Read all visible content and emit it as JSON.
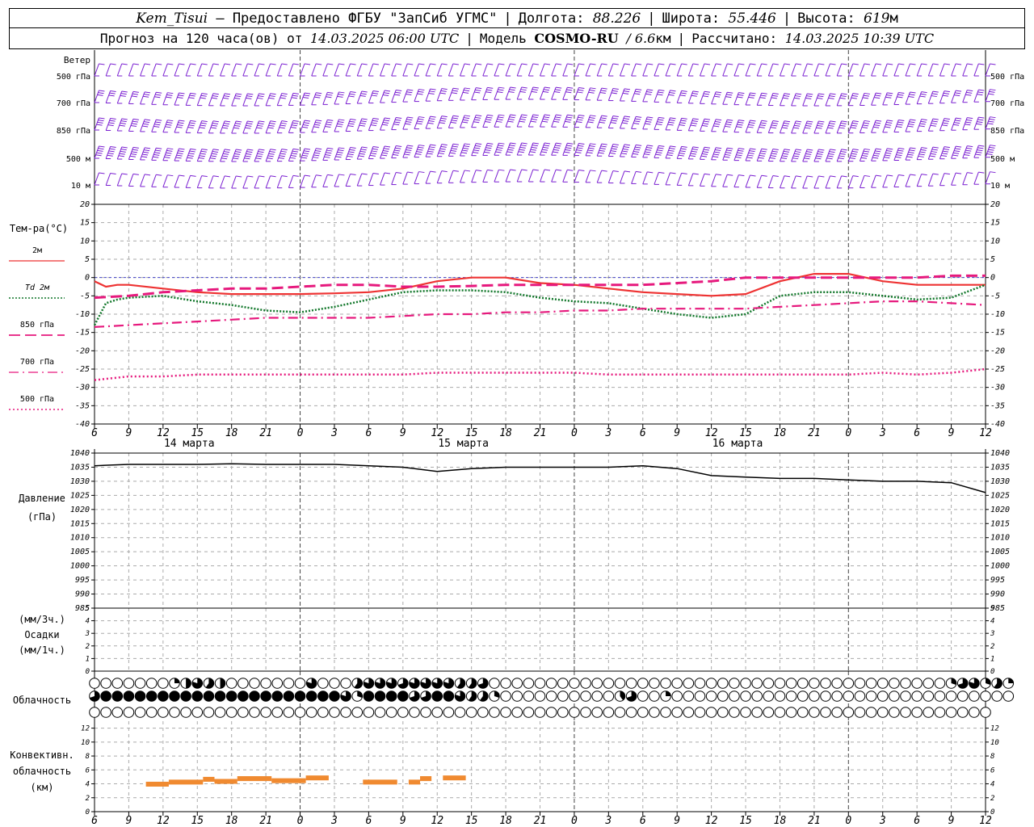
{
  "header": {
    "station": "Kem_Tisui",
    "provider_text": "– Предоставлено ФГБУ \"ЗапСиб УГМС\"",
    "lon_label": "Долгота:",
    "lon_value": "88.226",
    "lat_label": "Широта:",
    "lat_value": "55.446",
    "alt_label": "Высота:",
    "alt_value": "619",
    "alt_unit": "м",
    "forecast_prefix": "Прогноз на 120 часа(ов) от",
    "forecast_start": "14.03.2025 06:00 UTC",
    "model_label": "Модель",
    "model_name": "COSMO-RU",
    "model_res": "/ 6.6",
    "model_res_unit": "км",
    "calc_label": "Рассчитано:",
    "calc_time": "14.03.2025 10:39 UTC"
  },
  "panels": {
    "wind": {
      "title": "Ветер",
      "levels": [
        "500 гПа",
        "700 гПа",
        "850 гПа",
        "500 м",
        "10  м"
      ]
    },
    "temperature": {
      "title": "Тем-ра(°С)",
      "legend": [
        {
          "label": "2м",
          "color": "#ee3333",
          "dash": "solid"
        },
        {
          "label": "Td  2м",
          "color": "#11772a",
          "dash": "dotted"
        },
        {
          "label": "850 гПа",
          "color": "#e6197d",
          "dash": "dashed"
        },
        {
          "label": "700 гПа",
          "color": "#e6197d",
          "dash": "dashdot"
        },
        {
          "label": "500 гПа",
          "color": "#e6197d",
          "dash": "dot"
        }
      ],
      "y_ticks": [
        "20",
        "15",
        "10",
        "5",
        "0",
        "-5",
        "-10",
        "-15",
        "-20",
        "-25",
        "-30",
        "-35",
        "-40"
      ]
    },
    "pressure": {
      "title": "Давление",
      "unit": "(гПа)",
      "y_ticks": [
        "1040",
        "1035",
        "1030",
        "1025",
        "1020",
        "1015",
        "1010",
        "1005",
        "1000",
        "995",
        "990",
        "985"
      ]
    },
    "precip": {
      "unit1": "(мм/3ч.)",
      "title": "Осадки",
      "unit2": "(мм/1ч.)",
      "y_ticks": [
        "5",
        "4",
        "3",
        "2",
        "1",
        "0"
      ]
    },
    "clouds": {
      "title": "Облачность"
    },
    "convective": {
      "title1": "Конвективн.",
      "title2": "облачность",
      "unit": "(км)",
      "y_ticks": [
        "12",
        "10",
        "8",
        "6",
        "4",
        "2",
        "0"
      ]
    }
  },
  "time_axis": {
    "hour_labels": [
      "6",
      "9",
      "12",
      "15",
      "18",
      "21",
      "0",
      "3",
      "6",
      "9",
      "12",
      "15",
      "18",
      "21",
      "0",
      "3",
      "6",
      "9",
      "12",
      "15",
      "18",
      "21",
      "0",
      "3",
      "6",
      "9",
      "12"
    ],
    "day_labels": [
      "14 марта",
      "15 марта",
      "16 марта"
    ]
  },
  "chart_data": {
    "type": "line",
    "x_unit": "hours since 14.03.2025 06:00 UTC",
    "x_range": [
      0,
      78
    ],
    "temperature": {
      "ylim": [
        -40,
        20
      ],
      "series": [
        {
          "name": "2м",
          "x": [
            0,
            1,
            2,
            3,
            6,
            9,
            12,
            15,
            18,
            21,
            24,
            27,
            30,
            33,
            36,
            39,
            42,
            45,
            48,
            51,
            54,
            57,
            60,
            63,
            66,
            69,
            72,
            75,
            78
          ],
          "y": [
            -1,
            -2.5,
            -2,
            -2,
            -3,
            -4,
            -4.5,
            -4.5,
            -4.5,
            -4.3,
            -4,
            -3,
            -1,
            0,
            0,
            -1.5,
            -2,
            -3,
            -4,
            -4.5,
            -5,
            -4.5,
            -1,
            1,
            1,
            -1,
            -2,
            -2,
            -2
          ]
        },
        {
          "name": "Td  2м",
          "x": [
            0,
            1,
            2,
            3,
            6,
            9,
            12,
            15,
            18,
            21,
            24,
            27,
            30,
            33,
            36,
            39,
            42,
            45,
            48,
            51,
            54,
            57,
            60,
            63,
            66,
            69,
            72,
            75,
            78
          ],
          "y": [
            -13,
            -7,
            -6,
            -5.5,
            -5,
            -6.5,
            -7.5,
            -9,
            -9.5,
            -8,
            -6,
            -4,
            -3.5,
            -3.5,
            -4,
            -5.5,
            -6.5,
            -7,
            -8.5,
            -10,
            -11,
            -10,
            -5,
            -4,
            -4,
            -5,
            -6,
            -5.5,
            -2
          ]
        },
        {
          "name": "850 гПа",
          "x": [
            0,
            3,
            6,
            9,
            12,
            15,
            18,
            21,
            24,
            27,
            30,
            33,
            36,
            39,
            42,
            45,
            48,
            51,
            54,
            57,
            60,
            63,
            66,
            69,
            72,
            75,
            78
          ],
          "y": [
            -5.5,
            -5,
            -4,
            -3.5,
            -3,
            -3,
            -2.5,
            -2,
            -2,
            -2.5,
            -2.5,
            -2.3,
            -2,
            -2,
            -2,
            -2,
            -2,
            -1.5,
            -1,
            0,
            0,
            0,
            0,
            0,
            0,
            0.5,
            0.5
          ]
        },
        {
          "name": "700 гПа",
          "x": [
            0,
            3,
            6,
            9,
            12,
            15,
            18,
            21,
            24,
            27,
            30,
            33,
            36,
            39,
            42,
            45,
            48,
            51,
            54,
            57,
            60,
            63,
            66,
            69,
            72,
            75,
            78
          ],
          "y": [
            -13.5,
            -13,
            -12.5,
            -12,
            -11.5,
            -11,
            -11,
            -11,
            -11,
            -10.5,
            -10,
            -10,
            -9.5,
            -9.5,
            -9,
            -9,
            -8.5,
            -8.5,
            -8.5,
            -8.5,
            -8,
            -7.5,
            -7,
            -6.5,
            -6.5,
            -7,
            -7.5
          ]
        },
        {
          "name": "500 гПа",
          "x": [
            0,
            3,
            6,
            9,
            12,
            15,
            18,
            21,
            24,
            27,
            30,
            33,
            36,
            39,
            42,
            45,
            48,
            51,
            54,
            57,
            60,
            63,
            66,
            69,
            72,
            75,
            78
          ],
          "y": [
            -28,
            -27,
            -27,
            -26.5,
            -26.5,
            -26.5,
            -26.5,
            -26.5,
            -26.5,
            -26.5,
            -26,
            -26,
            -26,
            -26,
            -26,
            -26.5,
            -26.5,
            -26.5,
            -26.5,
            -26.5,
            -26.5,
            -26.5,
            -26.5,
            -26,
            -26.5,
            -26,
            -25
          ]
        }
      ]
    },
    "pressure": {
      "ylim": [
        985,
        1040
      ],
      "series": [
        {
          "x": [
            0,
            3,
            6,
            9,
            12,
            15,
            18,
            21,
            24,
            27,
            30,
            33,
            36,
            39,
            42,
            45,
            48,
            51,
            54,
            57,
            60,
            63,
            66,
            69,
            72,
            75,
            78
          ],
          "y": [
            1035.5,
            1036,
            1036,
            1036,
            1036.2,
            1036,
            1036,
            1036,
            1035.5,
            1035,
            1033.5,
            1034.5,
            1035,
            1035,
            1035,
            1035,
            1035.5,
            1034.5,
            1032,
            1031.5,
            1031,
            1031,
            1030.5,
            1030,
            1030,
            1029.5,
            1026
          ]
        }
      ]
    },
    "precipitation": {
      "ylim": [
        0,
        5
      ],
      "values": []
    },
    "convective_cloud_km": {
      "ylim": [
        0,
        13
      ],
      "segments": [
        {
          "x0": 4.5,
          "x1": 6.5,
          "top": 4.3
        },
        {
          "x0": 6.5,
          "x1": 9.5,
          "top": 4.6
        },
        {
          "x0": 9.5,
          "x1": 10.5,
          "top": 5.0
        },
        {
          "x0": 10.5,
          "x1": 12.5,
          "top": 4.7
        },
        {
          "x0": 12.5,
          "x1": 15.5,
          "top": 5.1
        },
        {
          "x0": 15.5,
          "x1": 18.5,
          "top": 4.8
        },
        {
          "x0": 18.5,
          "x1": 20.5,
          "top": 5.2
        },
        {
          "x0": 23.5,
          "x1": 26.5,
          "top": 4.6
        },
        {
          "x0": 27.5,
          "x1": 28.5,
          "top": 4.6
        },
        {
          "x0": 28.5,
          "x1": 29.5,
          "top": 5.1
        },
        {
          "x0": 30.5,
          "x1": 32.5,
          "top": 5.2
        }
      ]
    },
    "cloud_cover_fraction": {
      "high": [
        0,
        0,
        0,
        0,
        0,
        0,
        0,
        0.25,
        0.5,
        0.8,
        0.6,
        0.5,
        0,
        0,
        0,
        0,
        0,
        0,
        0,
        0.8,
        0,
        0,
        0,
        0.6,
        0.8,
        0.8,
        0.8,
        0.7,
        0.8,
        0.8,
        0.8,
        0.8,
        0.6,
        0.6,
        0.7,
        0,
        0,
        0,
        0,
        0,
        0,
        0,
        0,
        0,
        0,
        0,
        0,
        0,
        0,
        0,
        0,
        0,
        0,
        0,
        0,
        0,
        0,
        0,
        0,
        0,
        0,
        0,
        0,
        0,
        0,
        0,
        0,
        0,
        0,
        0,
        0,
        0,
        0,
        0,
        0,
        0.3,
        0.7,
        0.8,
        0.3,
        0.6,
        0.25
      ],
      "middle": [
        0.7,
        1,
        1,
        1,
        1,
        1,
        1,
        1,
        1,
        1,
        1,
        1,
        1,
        1,
        1,
        1,
        1,
        1,
        1,
        1,
        1,
        1,
        0.8,
        0.3,
        1,
        1,
        1,
        1,
        0.7,
        0.7,
        1,
        1,
        0.8,
        0.6,
        0.6,
        0.3,
        0,
        0,
        0,
        0,
        0,
        0,
        0,
        0,
        0,
        0,
        0.4,
        0.7,
        0,
        0,
        0.25,
        0,
        0,
        0,
        0,
        0,
        0,
        0,
        0,
        0,
        0,
        0,
        0,
        0,
        0,
        0,
        0,
        0,
        0,
        0,
        0,
        0,
        0,
        0,
        0,
        0,
        0,
        0,
        0,
        0,
        0
      ],
      "low": [
        0,
        0,
        0,
        0,
        0,
        0,
        0,
        0,
        0,
        0,
        0,
        0,
        0,
        0,
        0,
        0,
        0,
        0,
        0,
        0,
        0,
        0,
        0,
        0,
        0,
        0,
        0,
        0,
        0,
        0,
        0,
        0,
        0,
        0,
        0,
        0,
        0,
        0,
        0,
        0,
        0,
        0,
        0,
        0,
        0,
        0,
        0,
        0,
        0,
        0,
        0,
        0,
        0,
        0,
        0,
        0,
        0,
        0,
        0,
        0,
        0,
        0,
        0,
        0,
        0,
        0,
        0,
        0,
        0,
        0,
        0,
        0,
        0,
        0,
        0,
        0,
        0,
        0,
        0
      ]
    },
    "wind_barbs": {
      "levels": [
        "500 гПа",
        "700 гПа",
        "850 гПа",
        "500 м",
        "10  м"
      ],
      "speed_ms": [
        [
          5,
          5,
          5,
          5,
          5,
          5,
          5,
          5,
          5,
          5,
          5,
          5,
          5,
          5,
          5,
          5,
          5,
          5,
          5,
          5,
          5,
          5,
          5,
          5,
          5,
          5,
          5,
          5,
          5,
          5,
          5,
          5,
          5,
          5,
          5,
          5,
          5,
          5,
          5,
          5,
          5,
          5,
          5,
          5,
          5,
          5,
          5,
          5,
          5,
          5,
          5,
          5,
          5,
          5,
          5,
          5,
          5,
          5,
          5,
          5,
          5,
          5,
          5,
          5,
          5,
          5,
          5,
          5,
          5,
          5,
          5,
          5,
          5,
          5,
          5,
          5,
          5,
          5,
          5
        ],
        [
          15,
          15,
          15,
          15,
          15,
          15,
          15,
          15,
          15,
          15,
          15,
          15,
          15,
          15,
          15,
          15,
          15,
          15,
          15,
          15,
          15,
          15,
          15,
          15,
          15,
          15,
          15,
          15,
          15,
          15,
          15,
          15,
          15,
          15,
          15,
          15,
          15,
          15,
          15,
          15,
          15,
          15,
          15,
          15,
          15,
          15,
          15,
          15,
          15,
          15,
          15,
          15,
          15,
          15,
          15,
          15,
          15,
          15,
          15,
          15,
          15,
          15,
          15,
          15,
          15,
          15,
          15,
          15,
          15,
          15,
          15,
          15,
          15,
          15,
          15,
          15,
          15,
          15,
          15
        ],
        [
          20,
          20,
          20,
          20,
          20,
          20,
          20,
          20,
          20,
          20,
          20,
          20,
          20,
          20,
          20,
          20,
          20,
          20,
          20,
          20,
          20,
          20,
          20,
          20,
          20,
          20,
          20,
          20,
          20,
          20,
          20,
          20,
          20,
          20,
          20,
          20,
          20,
          20,
          20,
          20,
          20,
          20,
          20,
          20,
          20,
          20,
          20,
          20,
          20,
          20,
          20,
          20,
          20,
          20,
          20,
          20,
          20,
          20,
          20,
          20,
          20,
          20,
          20,
          20,
          20,
          20,
          20,
          20,
          20,
          20,
          20,
          20,
          20,
          20,
          20,
          20,
          20,
          20,
          20
        ],
        [
          25,
          25,
          25,
          25,
          25,
          25,
          25,
          25,
          25,
          25,
          25,
          25,
          25,
          25,
          25,
          25,
          25,
          25,
          25,
          25,
          25,
          25,
          25,
          25,
          25,
          25,
          25,
          25,
          25,
          25,
          25,
          25,
          25,
          25,
          25,
          25,
          25,
          25,
          25,
          25,
          25,
          25,
          25,
          25,
          25,
          25,
          25,
          25,
          25,
          25,
          25,
          25,
          25,
          25,
          25,
          25,
          25,
          25,
          25,
          25,
          25,
          25,
          25,
          25,
          25,
          25,
          25,
          25,
          25,
          25,
          25,
          25,
          25,
          25,
          25,
          25,
          25,
          25,
          25
        ],
        [
          5,
          5,
          5,
          5,
          5,
          5,
          5,
          5,
          5,
          5,
          5,
          5,
          5,
          5,
          5,
          5,
          5,
          5,
          5,
          5,
          5,
          5,
          5,
          5,
          5,
          5,
          5,
          5,
          5,
          5,
          5,
          5,
          5,
          5,
          5,
          5,
          5,
          5,
          5,
          5,
          5,
          5,
          5,
          5,
          5,
          5,
          5,
          5,
          5,
          5,
          5,
          5,
          5,
          5,
          5,
          5,
          5,
          5,
          5,
          5,
          5,
          5,
          5,
          5,
          5,
          5,
          5,
          5,
          5,
          5,
          5,
          5,
          5,
          5,
          5,
          5,
          5,
          5,
          5
        ]
      ]
    },
    "colors": {
      "t2m": "#ee3333",
      "td2m": "#11772a",
      "upper": "#e6197d",
      "wind": "#7a1fd1",
      "pressure": "#000000",
      "convective": "#f08a30",
      "grid": "#aaaaaa"
    }
  }
}
